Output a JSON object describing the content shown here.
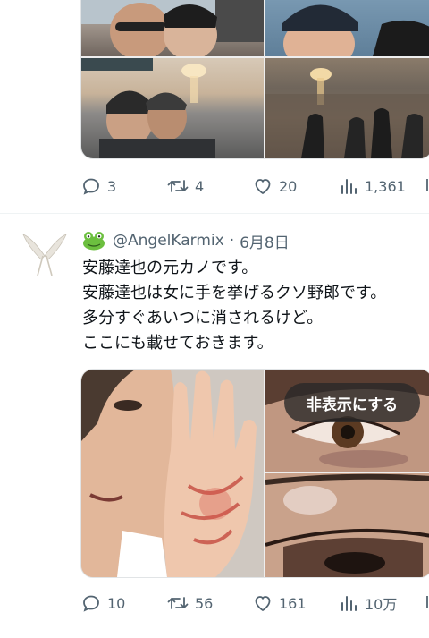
{
  "tweet1": {
    "stats": {
      "replies": "3",
      "retweets": "4",
      "likes": "20",
      "views": "1,361"
    }
  },
  "tweet2": {
    "handle": "@AngelKarmix",
    "separator": "·",
    "date": "6月8日",
    "text_lines": [
      "安藤達也の元カノです。",
      "安藤達也は女に手を挙げるクソ野郎です。",
      "多分すぐあいつに消されるけど。",
      "ここにも載せておきます。"
    ],
    "hide_button": "非表示にする",
    "stats": {
      "replies": "10",
      "retweets": "56",
      "likes": "161",
      "views": "10万"
    }
  }
}
